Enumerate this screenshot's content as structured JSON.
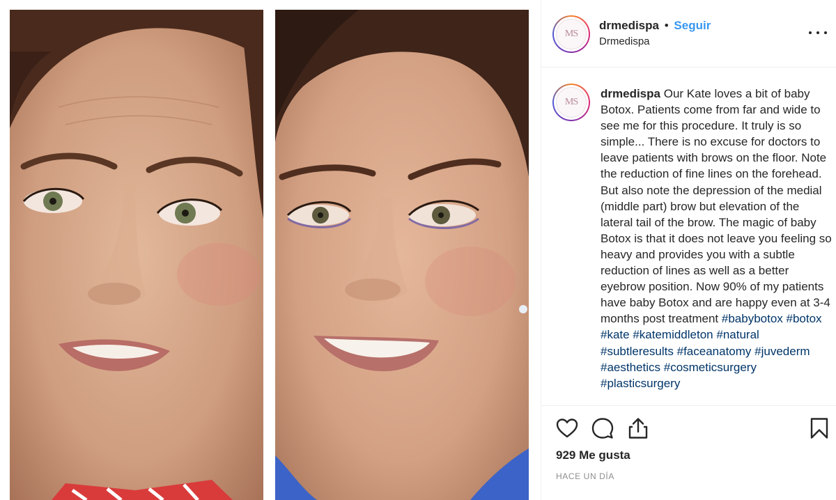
{
  "post": {
    "username": "drmedispa",
    "separator": "•",
    "follow_label": "Seguir",
    "subtitle": "Drmedispa",
    "avatar_monogram": "MS"
  },
  "caption": {
    "username": "drmedispa",
    "text": "Our Kate loves a bit of baby Botox. Patients come from far and wide to see me for this procedure. It truly is so simple... There is no excuse for doctors to leave patients with brows on the floor. Note the reduction of fine lines on the forehead. But also note the depression of the medial (middle part) brow but elevation of the lateral tail of the brow. The magic of baby Botox is that it does not leave you feeling so heavy and provides you with a subtle reduction of lines as well as a better eyebrow position. Now 90% of my patients have baby Botox and are happy even at 3-4 months post treatment",
    "hashtags": [
      "#babybotox",
      "#botox",
      "#kate",
      "#katemiddleton",
      "#natural",
      "#subtleresults",
      "#faceanatomy",
      "#juvederm",
      "#aesthetics",
      "#cosmeticsurgery",
      "#plasticsurgery"
    ]
  },
  "actions": {
    "like_icon": "heart-icon",
    "comment_icon": "comment-icon",
    "share_icon": "share-icon",
    "save_icon": "bookmark-icon"
  },
  "likes": "929 Me gusta",
  "timestamp": "HACE UN DÍA",
  "colors": {
    "link_blue": "#3897f0",
    "hashtag_blue": "#003569",
    "text": "#262626",
    "muted": "#8e8e8e",
    "divider": "#efefef"
  }
}
